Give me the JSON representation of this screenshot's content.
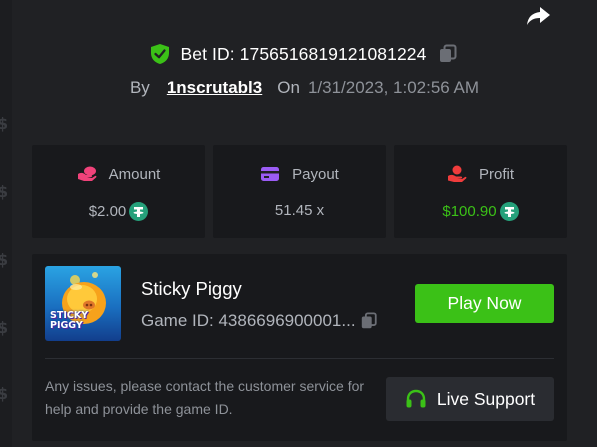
{
  "colors": {
    "accent_green": "#3bc117",
    "panel_bg": "#202124",
    "card_bg": "#18191c",
    "muted_text": "#b1b5bc",
    "usdt": "#26a17b"
  },
  "header": {
    "share_icon": "share-arrow-icon",
    "bet_id_label": "Bet ID: 1756516819121081224",
    "copy_icon": "copy-icon",
    "by_label": "By",
    "username": "1nscrutabl3",
    "on_label": "On",
    "timestamp": "1/31/2023, 1:02:56 AM"
  },
  "stats": [
    {
      "icon": "coins-icon",
      "label": "Amount",
      "value": "$2.00",
      "currency_icon": "usdt-coin-icon"
    },
    {
      "icon": "wallet-icon",
      "label": "Payout",
      "value": "51.45 x"
    },
    {
      "icon": "profit-hand-icon",
      "label": "Profit",
      "value": "$100.90",
      "currency_icon": "usdt-coin-icon"
    }
  ],
  "game": {
    "thumbnail_text": "STICKY PIGGY",
    "title": "Sticky Piggy",
    "game_id_label": "Game ID: 4386696900001...",
    "play_button": "Play Now",
    "help_text": "Any issues, please contact the customer service for help and provide the game ID.",
    "support_button": "Live Support",
    "support_icon": "headset-icon"
  }
}
